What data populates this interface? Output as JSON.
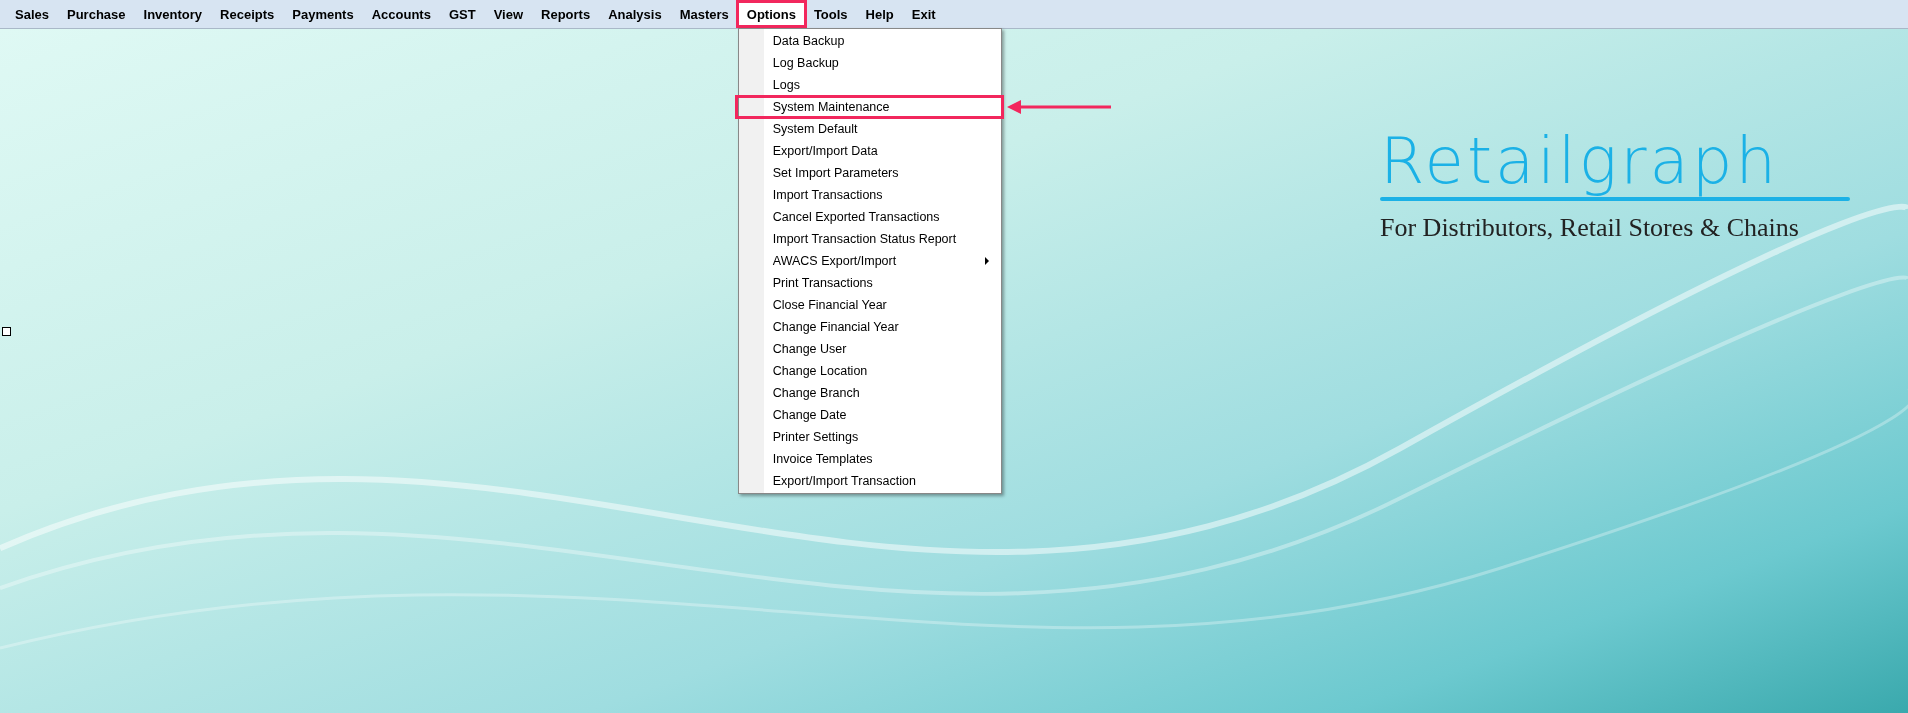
{
  "menu_bar": {
    "items": [
      {
        "label": "Sales",
        "selected": false,
        "annotated": false
      },
      {
        "label": "Purchase",
        "selected": false,
        "annotated": false
      },
      {
        "label": "Inventory",
        "selected": false,
        "annotated": false
      },
      {
        "label": "Receipts",
        "selected": false,
        "annotated": false
      },
      {
        "label": "Payments",
        "selected": false,
        "annotated": false
      },
      {
        "label": "Accounts",
        "selected": false,
        "annotated": false
      },
      {
        "label": "GST",
        "selected": false,
        "annotated": false
      },
      {
        "label": "View",
        "selected": false,
        "annotated": false
      },
      {
        "label": "Reports",
        "selected": false,
        "annotated": false
      },
      {
        "label": "Analysis",
        "selected": false,
        "annotated": false
      },
      {
        "label": "Masters",
        "selected": false,
        "annotated": false
      },
      {
        "label": "Options",
        "selected": true,
        "annotated": true
      },
      {
        "label": "Tools",
        "selected": false,
        "annotated": false
      },
      {
        "label": "Help",
        "selected": false,
        "annotated": false
      },
      {
        "label": "Exit",
        "selected": false,
        "annotated": false
      }
    ]
  },
  "dropdown": {
    "items": [
      {
        "label": "Data Backup",
        "has_submenu": false,
        "annotated": false
      },
      {
        "label": "Log Backup",
        "has_submenu": false,
        "annotated": false
      },
      {
        "label": "Logs",
        "has_submenu": false,
        "annotated": false
      },
      {
        "label": "System Maintenance",
        "has_submenu": false,
        "annotated": true
      },
      {
        "label": "System Default",
        "has_submenu": false,
        "annotated": false
      },
      {
        "label": "Export/Import Data",
        "has_submenu": false,
        "annotated": false
      },
      {
        "label": "Set Import Parameters",
        "has_submenu": false,
        "annotated": false
      },
      {
        "label": "Import Transactions",
        "has_submenu": false,
        "annotated": false
      },
      {
        "label": "Cancel Exported Transactions",
        "has_submenu": false,
        "annotated": false
      },
      {
        "label": "Import Transaction Status Report",
        "has_submenu": false,
        "annotated": false
      },
      {
        "label": "AWACS Export/Import",
        "has_submenu": true,
        "annotated": false
      },
      {
        "label": "Print Transactions",
        "has_submenu": false,
        "annotated": false
      },
      {
        "label": "Close Financial Year",
        "has_submenu": false,
        "annotated": false
      },
      {
        "label": "Change Financial Year",
        "has_submenu": false,
        "annotated": false
      },
      {
        "label": "Change User",
        "has_submenu": false,
        "annotated": false
      },
      {
        "label": "Change Location",
        "has_submenu": false,
        "annotated": false
      },
      {
        "label": "Change Branch",
        "has_submenu": false,
        "annotated": false
      },
      {
        "label": "Change Date",
        "has_submenu": false,
        "annotated": false
      },
      {
        "label": "Printer Settings",
        "has_submenu": false,
        "annotated": false
      },
      {
        "label": "Invoice Templates",
        "has_submenu": false,
        "annotated": false
      },
      {
        "label": "Export/Import Transaction",
        "has_submenu": false,
        "annotated": false
      }
    ]
  },
  "logo": {
    "name": "Retailgraph",
    "tagline": "For Distributors, Retail Stores & Chains"
  }
}
